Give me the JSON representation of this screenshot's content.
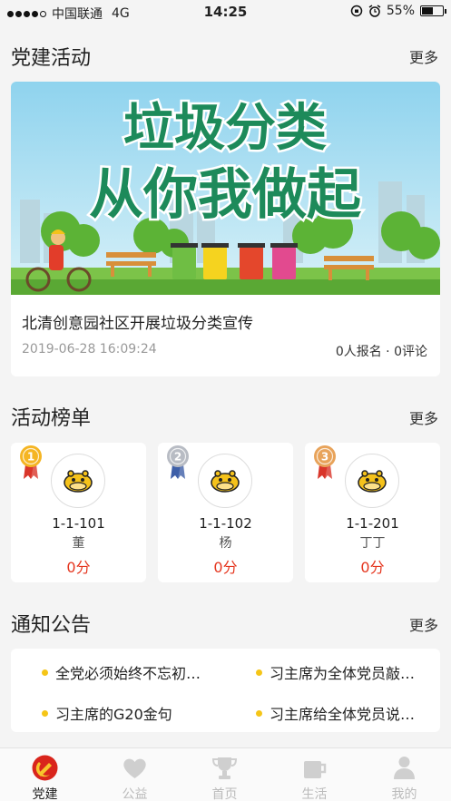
{
  "status_bar": {
    "carrier": "中国联通",
    "network": "4G",
    "time": "14:25",
    "battery": "55%",
    "battery_level": 0.55
  },
  "party_activities": {
    "title": "党建活动",
    "more": "更多",
    "banner_line1": "垃圾分类",
    "banner_line2": "从你我做起",
    "activity_title": "北清创意园社区开展垃圾分类宣传",
    "date": "2019-06-28 16:09:24",
    "meta": "0人报名 · 0评论"
  },
  "ranking": {
    "title": "活动榜单",
    "more": "更多",
    "items": [
      {
        "rank": "1",
        "room": "1-1-101",
        "name": "董",
        "score": "0分",
        "medal_color": "#f5b523",
        "ribbon": "#d9362b"
      },
      {
        "rank": "2",
        "room": "1-1-102",
        "name": "杨",
        "score": "0分",
        "medal_color": "#b8bcc4",
        "ribbon": "#3e5fa8"
      },
      {
        "rank": "3",
        "room": "1-1-201",
        "name": "丁丁",
        "score": "0分",
        "medal_color": "#e8a35a",
        "ribbon": "#d9362b"
      }
    ]
  },
  "notices": {
    "title": "通知公告",
    "more": "更多",
    "items": [
      "全党必须始终不忘初…",
      "习主席为全体党员敲…",
      "习主席的G20金句",
      "习主席给全体党员说…"
    ]
  },
  "tabs": [
    {
      "label": "党建",
      "icon": "party-emblem-icon",
      "active": true
    },
    {
      "label": "公益",
      "icon": "heart-icon",
      "active": false
    },
    {
      "label": "首页",
      "icon": "trophy-icon",
      "active": false
    },
    {
      "label": "生活",
      "icon": "cup-icon",
      "active": false
    },
    {
      "label": "我的",
      "icon": "person-icon",
      "active": false
    }
  ],
  "colors": {
    "accent_red": "#e5361f",
    "notice_dot": "#f5c517",
    "party_red": "#d9251c",
    "party_gold": "#f7c52c"
  }
}
